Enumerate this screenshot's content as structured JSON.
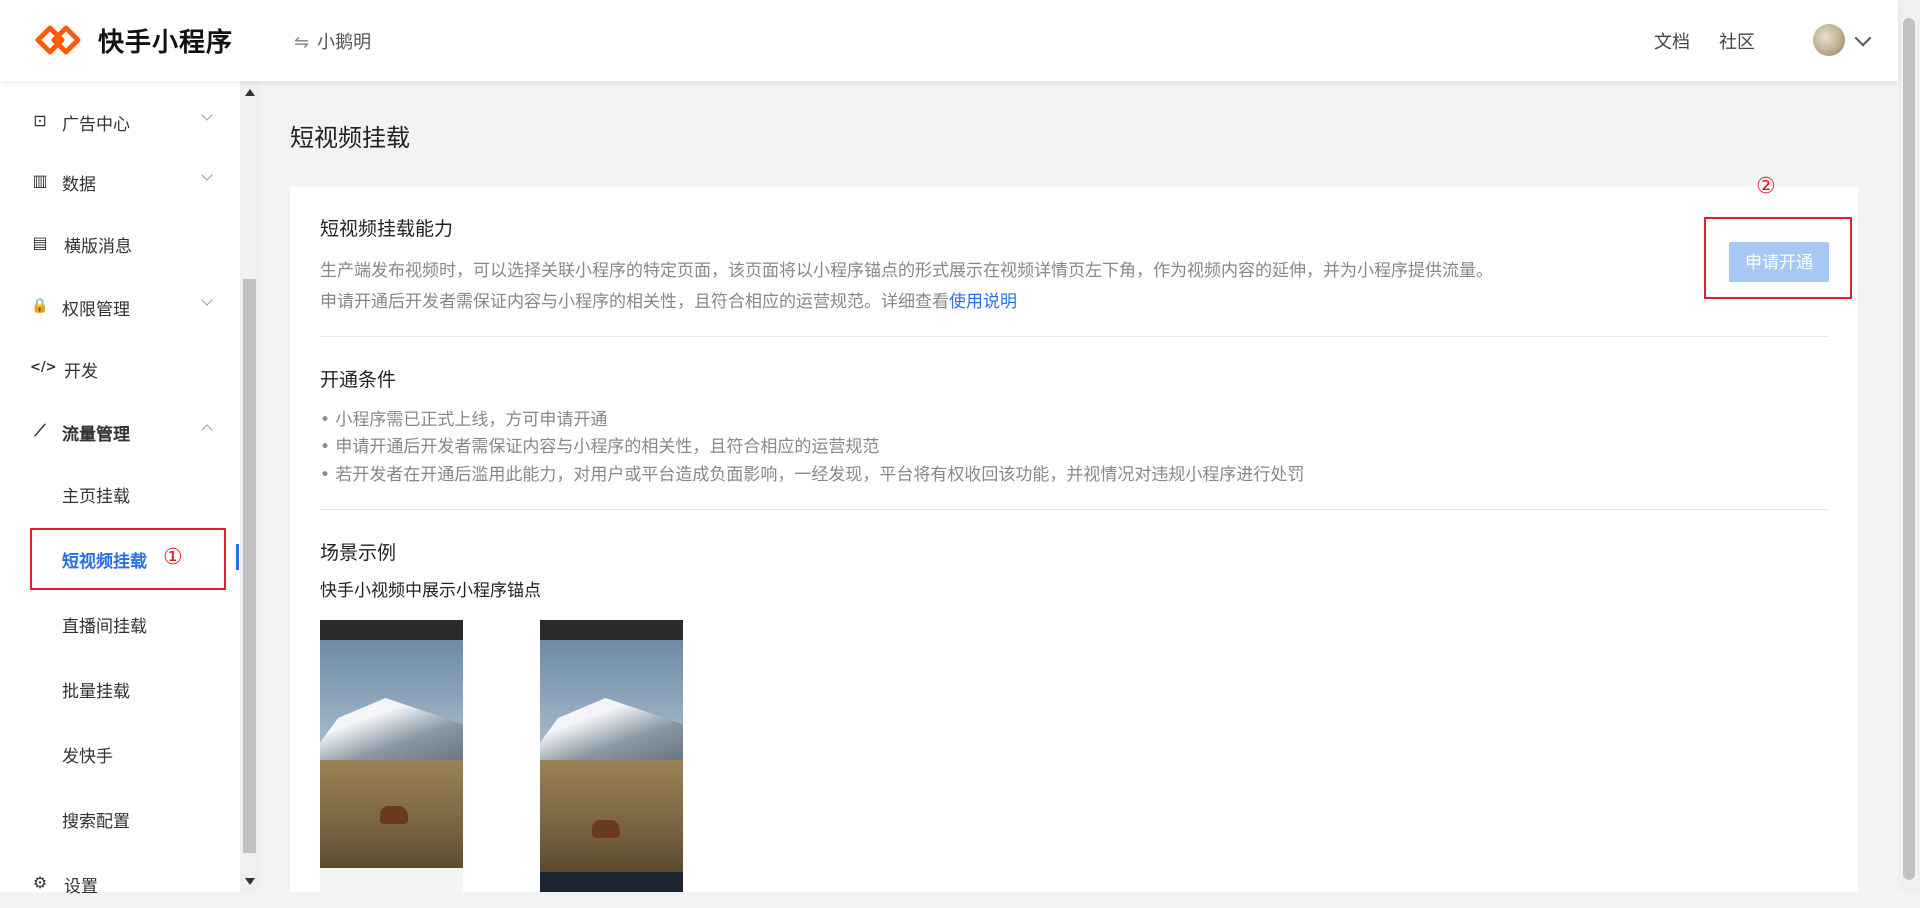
{
  "app": {
    "brand": "快手小程序",
    "account": "小鹅明",
    "switch_icon": "⇋"
  },
  "topnav": {
    "docs": "文档",
    "community": "社区"
  },
  "sidebar": {
    "items": [
      {
        "label": "广告中心",
        "icon": "ad-center-icon",
        "glyph": "⊡",
        "expand": "down"
      },
      {
        "label": "数据",
        "icon": "data-chart-icon",
        "glyph": "▥",
        "expand": "down"
      },
      {
        "label": "横版消息",
        "icon": "message-icon",
        "glyph": "▤",
        "expand": "none"
      },
      {
        "label": "权限管理",
        "icon": "lock-icon",
        "glyph": "🔒",
        "expand": "down"
      },
      {
        "label": "开发",
        "icon": "code-icon",
        "glyph": "</>",
        "expand": "none"
      },
      {
        "label": "流量管理",
        "icon": "traffic-chart-icon",
        "glyph": "⟋",
        "expand": "up"
      }
    ],
    "sub_items": [
      "主页挂载",
      "短视频挂载",
      "直播间挂载",
      "批量挂载",
      "发快手",
      "搜索配置"
    ],
    "settings": "设置"
  },
  "markers": {
    "one": "①",
    "two": "②"
  },
  "page": {
    "title": "短视频挂载"
  },
  "capability": {
    "title": "短视频挂载能力",
    "line1": "生产端发布视频时，可以选择关联小程序的特定页面，该页面将以小程序锚点的形式展示在视频详情页左下角，作为视频内容的延伸，并为小程序提供流量。",
    "line2_prefix": "申请开通后开发者需保证内容与小程序的相关性，且符合相应的运营规范。详细查看",
    "line2_link": "使用说明",
    "apply_button": "申请开通"
  },
  "conditions": {
    "title": "开通条件",
    "items": [
      "• 小程序需已正式上线，方可申请开通",
      "• 申请开通后开发者需保证内容与小程序的相关性，且符合相应的运营规范",
      "• 若开发者在开通后滥用此能力，对用户或平台造成负面影响，一经发现，平台将有权收回该功能，并视情况对违规小程序进行处罚"
    ]
  },
  "scenes": {
    "title": "场景示例",
    "subtitle": "快手小视频中展示小程序锚点"
  },
  "colors": {
    "accent": "#2b6fe6",
    "marker": "#e0202a",
    "logo": "#ff5b0a"
  }
}
